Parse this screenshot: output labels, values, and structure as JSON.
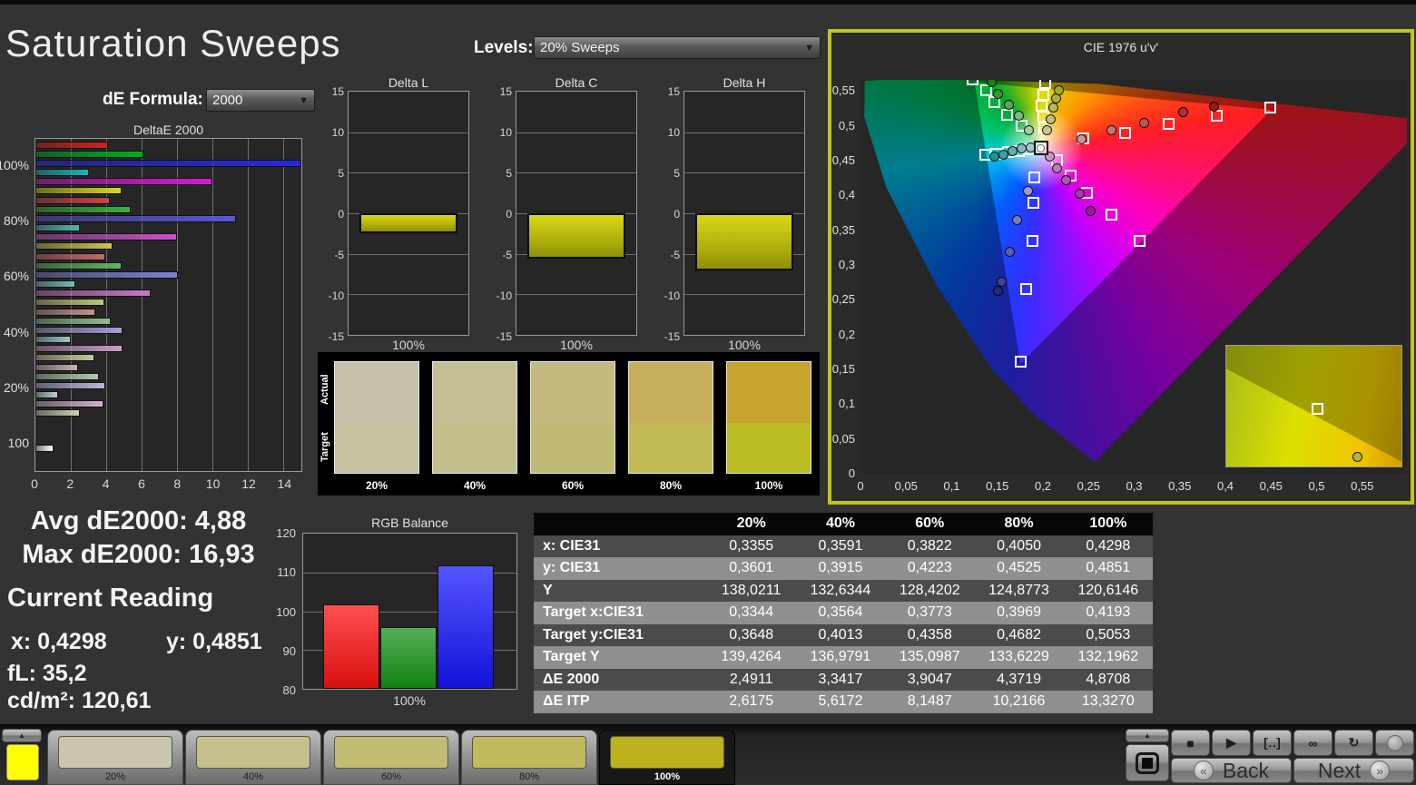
{
  "page": {
    "title": "Saturation Sweeps"
  },
  "de_formula": {
    "label": "dE Formula:",
    "value": "2000",
    "arrow": "▼"
  },
  "levels": {
    "label": "Levels:",
    "value": "20% Sweeps",
    "arrow": "▼"
  },
  "chart_data": [
    {
      "type": "bar",
      "title": "DeltaE 2000",
      "orientation": "horizontal",
      "xlim": [
        0,
        15
      ],
      "xticks": [
        0,
        2,
        4,
        6,
        8,
        10,
        12,
        14
      ],
      "series_order": [
        "red",
        "green",
        "blue",
        "cyan",
        "magenta",
        "yellow"
      ],
      "groups": [
        {
          "label": "100%",
          "values": [
            4.1,
            6.1,
            15.2,
            3.0,
            10.0,
            4.87
          ],
          "colors": [
            "#d42020",
            "#00b020",
            "#2828e0",
            "#18b8b8",
            "#d818d8",
            "#d8d818"
          ]
        },
        {
          "label": "80%",
          "values": [
            4.2,
            5.35,
            11.3,
            2.5,
            8.0,
            4.37
          ],
          "colors": [
            "#cc4444",
            "#3cb23c",
            "#5858d8",
            "#4cb8b8",
            "#cc50cc",
            "#c8c84c"
          ]
        },
        {
          "label": "60%",
          "values": [
            3.93,
            4.84,
            8.03,
            2.26,
            6.48,
            3.9
          ],
          "colors": [
            "#c86868",
            "#64b464",
            "#8080d4",
            "#74bcbc",
            "#c878c8",
            "#c4c474"
          ]
        },
        {
          "label": "40%",
          "values": [
            3.4,
            4.27,
            4.93,
            1.98,
            4.93,
            3.34
          ],
          "colors": [
            "#c89090",
            "#90c090",
            "#a0a0d8",
            "#9cc8c8",
            "#cc9ccc",
            "#c8c89c"
          ]
        },
        {
          "label": "20%",
          "values": [
            2.43,
            3.59,
            3.93,
            1.26,
            3.84,
            2.49
          ],
          "colors": [
            "#ccb0b0",
            "#b0ccb0",
            "#b8b8dc",
            "#b8d4d4",
            "#d0b4d0",
            "#d0d0b4"
          ]
        },
        {
          "label": "100",
          "values": [
            1.0
          ],
          "colors": [
            "#ffffff"
          ]
        }
      ]
    },
    {
      "type": "bar",
      "title": "Delta L",
      "xlabel": "100%",
      "ylim": [
        -15,
        15
      ],
      "yticks": [
        15,
        10,
        5,
        0,
        -5,
        -10,
        -15
      ],
      "value": -2.5
    },
    {
      "type": "bar",
      "title": "Delta C",
      "xlabel": "100%",
      "ylim": [
        -15,
        15
      ],
      "yticks": [
        15,
        10,
        5,
        0,
        -5,
        -10,
        -15
      ],
      "value": -5.6
    },
    {
      "type": "bar",
      "title": "Delta H",
      "xlabel": "100%",
      "ylim": [
        -15,
        15
      ],
      "yticks": [
        15,
        10,
        5,
        0,
        -5,
        -10,
        -15
      ],
      "value": -7.0
    },
    {
      "type": "bar",
      "title": "RGB Balance",
      "xlabel": "100%",
      "ylim": [
        80,
        120
      ],
      "yticks": [
        120,
        110,
        100,
        90,
        80
      ],
      "gridlines": [
        110,
        100,
        90
      ],
      "series": [
        {
          "name": "red",
          "value": 101.8,
          "color_top": "#ff5050",
          "color_bottom": "#d90f0f"
        },
        {
          "name": "green",
          "value": 95.8,
          "color_top": "#55b055",
          "color_bottom": "#148014"
        },
        {
          "name": "blue",
          "value": 111.8,
          "color_top": "#5555ff",
          "color_bottom": "#1212d9"
        }
      ]
    },
    {
      "type": "scatter",
      "title": "CIE 1976 u'v'",
      "xticks": [
        [
          "0",
          0
        ],
        [
          "0,05",
          0.05
        ],
        [
          "0,1",
          0.1
        ],
        [
          "0,15",
          0.15
        ],
        [
          "0,2",
          0.2
        ],
        [
          "0,25",
          0.25
        ],
        [
          "0,3",
          0.3
        ],
        [
          "0,35",
          0.35
        ],
        [
          "0,4",
          0.4
        ],
        [
          "0,45",
          0.45
        ],
        [
          "0,5",
          0.5
        ],
        [
          "0,55",
          0.55
        ]
      ],
      "yticks": [
        [
          "0,55",
          0.55
        ],
        [
          "0,5",
          0.5
        ],
        [
          "0,45",
          0.45
        ],
        [
          "0,4",
          0.4
        ],
        [
          "0,35",
          0.35
        ],
        [
          "0,3",
          0.3
        ],
        [
          "0,25",
          0.25
        ],
        [
          "0,2",
          0.2
        ],
        [
          "0,15",
          0.15
        ],
        [
          "0,1",
          0.1
        ],
        [
          "0,05",
          0.05
        ],
        [
          "0",
          0
        ]
      ],
      "white_point": {
        "target": [
          0.198,
          0.468
        ]
      },
      "targets": {
        "green": [
          [
            0.177,
            0.5
          ],
          [
            0.161,
            0.516
          ],
          [
            0.147,
            0.534
          ],
          [
            0.138,
            0.551
          ],
          [
            0.123,
            0.566
          ]
        ],
        "yellow": [
          [
            0.201,
            0.497
          ],
          [
            0.2,
            0.513
          ],
          [
            0.199,
            0.529
          ],
          [
            0.2,
            0.544
          ],
          [
            0.202,
            0.561
          ]
        ],
        "red": [
          [
            0.244,
            0.482
          ],
          [
            0.29,
            0.49
          ],
          [
            0.338,
            0.502
          ],
          [
            0.391,
            0.514
          ],
          [
            0.449,
            0.526
          ]
        ],
        "cyan": [
          [
            0.186,
            0.466
          ],
          [
            0.174,
            0.464
          ],
          [
            0.162,
            0.462
          ],
          [
            0.149,
            0.46
          ],
          [
            0.137,
            0.458
          ]
        ],
        "magenta": [
          [
            0.215,
            0.45
          ],
          [
            0.23,
            0.428
          ],
          [
            0.248,
            0.404
          ],
          [
            0.275,
            0.372
          ],
          [
            0.306,
            0.334
          ]
        ],
        "blue": [
          [
            0.191,
            0.426
          ],
          [
            0.19,
            0.389
          ],
          [
            0.189,
            0.335
          ],
          [
            0.182,
            0.265
          ],
          [
            0.176,
            0.161
          ]
        ]
      },
      "measured": {
        "green": [
          [
            0.185,
            0.494
          ],
          [
            0.174,
            0.514
          ],
          [
            0.163,
            0.53
          ],
          [
            0.151,
            0.546
          ],
          [
            0.144,
            0.562
          ]
        ],
        "yellow": [
          [
            0.204,
            0.494
          ],
          [
            0.208,
            0.509
          ],
          [
            0.211,
            0.526
          ],
          [
            0.214,
            0.539
          ],
          [
            0.217,
            0.551
          ]
        ],
        "red": [
          [
            0.242,
            0.481
          ],
          [
            0.275,
            0.493
          ],
          [
            0.311,
            0.504
          ],
          [
            0.354,
            0.519
          ],
          [
            0.388,
            0.527
          ]
        ],
        "cyan": [
          [
            0.187,
            0.469
          ],
          [
            0.177,
            0.467
          ],
          [
            0.167,
            0.463
          ],
          [
            0.157,
            0.458
          ],
          [
            0.147,
            0.456
          ]
        ],
        "magenta": [
          [
            0.207,
            0.456
          ],
          [
            0.215,
            0.439
          ],
          [
            0.225,
            0.422
          ],
          [
            0.24,
            0.402
          ],
          [
            0.252,
            0.378
          ]
        ],
        "blue": [
          [
            0.184,
            0.406
          ],
          [
            0.172,
            0.365
          ],
          [
            0.164,
            0.319
          ],
          [
            0.155,
            0.276
          ],
          [
            0.151,
            0.263
          ]
        ]
      },
      "measured_fills": {
        "green": [
          "#a9c9a9",
          "#7dbb7d",
          "#51ad51",
          "#2f9e2f",
          "#138413"
        ],
        "yellow": [
          "#c6c69a",
          "#c0c07c",
          "#b8b85e",
          "#b0b040",
          "#aaaa22"
        ],
        "red": [
          "#c49a9a",
          "#c07878",
          "#ba5656",
          "#ac3434",
          "#901c1c"
        ],
        "cyan": [
          "#a6caca",
          "#84bcbc",
          "#62aeae",
          "#40a0a0",
          "#209292"
        ],
        "magenta": [
          "#c49cc4",
          "#ba7aba",
          "#b058b0",
          "#a636a6",
          "#961a96"
        ],
        "blue": [
          "#9a9ace",
          "#7c7cbe",
          "#5e5eae",
          "#40409a",
          "#28287e"
        ]
      },
      "inset": {
        "square_pct": [
          48.7,
          47.0
        ],
        "circle_pct": [
          71.8,
          88.0
        ],
        "circle_fill": "#b8b82a"
      }
    }
  ],
  "swatch_strip": {
    "row_labels": [
      "Actual",
      "Target"
    ],
    "items": [
      {
        "label": "20%",
        "actual": "#c6c2a9",
        "target": "#c5c2a1"
      },
      {
        "label": "40%",
        "actual": "#c5be95",
        "target": "#c2bf8d"
      },
      {
        "label": "60%",
        "actual": "#c4b97e",
        "target": "#bfbb75"
      },
      {
        "label": "80%",
        "actual": "#c8af5b",
        "target": "#c2bb55"
      },
      {
        "label": "100%",
        "actual": "#c7a42c",
        "target": "#bcbc23"
      }
    ]
  },
  "stats": {
    "avg": "Avg dE2000: 4,88",
    "max": "Max dE2000: 16,93"
  },
  "current_reading": {
    "title": "Current Reading",
    "x": "x: 0,4298",
    "y": "y: 0,4851",
    "fl": "fL: 35,2",
    "cdm2": "cd/m²: 120,61"
  },
  "table": {
    "columns": [
      "",
      "20%",
      "40%",
      "60%",
      "80%",
      "100%"
    ],
    "rows": [
      {
        "label": "x: CIE31",
        "values": [
          "0,3355",
          "0,3591",
          "0,3822",
          "0,4050",
          "0,4298"
        ]
      },
      {
        "label": "y: CIE31",
        "values": [
          "0,3601",
          "0,3915",
          "0,4223",
          "0,4525",
          "0,4851"
        ]
      },
      {
        "label": "Y",
        "values": [
          "138,0211",
          "132,6344",
          "128,4202",
          "124,8773",
          "120,6146"
        ]
      },
      {
        "label": "Target x:CIE31",
        "values": [
          "0,3344",
          "0,3564",
          "0,3773",
          "0,3969",
          "0,4193"
        ]
      },
      {
        "label": "Target y:CIE31",
        "values": [
          "0,3648",
          "0,4013",
          "0,4358",
          "0,4682",
          "0,5053"
        ]
      },
      {
        "label": "Target Y",
        "values": [
          "139,4264",
          "136,9791",
          "135,0987",
          "133,6229",
          "132,1962"
        ]
      },
      {
        "label": "ΔE 2000",
        "values": [
          "2,4911",
          "3,3417",
          "3,9047",
          "4,3719",
          "4,8708"
        ]
      },
      {
        "label": "ΔE ITP",
        "values": [
          "2,6175",
          "5,6172",
          "8,1487",
          "10,2166",
          "13,3270"
        ]
      }
    ]
  },
  "toolbar": {
    "current_patch_color": "#ffff00",
    "samples": [
      {
        "label": "20%",
        "color": "#c9c6ab",
        "selected": false
      },
      {
        "label": "40%",
        "color": "#c5c18d",
        "selected": false
      },
      {
        "label": "60%",
        "color": "#c2bc72",
        "selected": false
      },
      {
        "label": "80%",
        "color": "#c1b95c",
        "selected": false
      },
      {
        "label": "100%",
        "color": "#beb21c",
        "selected": true
      }
    ],
    "up_arrow": "▲",
    "transport_icons": [
      {
        "name": "stop-icon",
        "glyph": "■"
      },
      {
        "name": "play-icon",
        "glyph": "▶"
      },
      {
        "name": "range-icon",
        "glyph": "[‥]"
      },
      {
        "name": "infinity-icon",
        "glyph": "∞"
      },
      {
        "name": "loop-icon",
        "glyph": "↻"
      },
      {
        "name": "lens-icon",
        "glyph": ""
      }
    ],
    "back_label": "Back",
    "next_label": "Next",
    "back_arrow": "«",
    "next_arrow": "»"
  }
}
